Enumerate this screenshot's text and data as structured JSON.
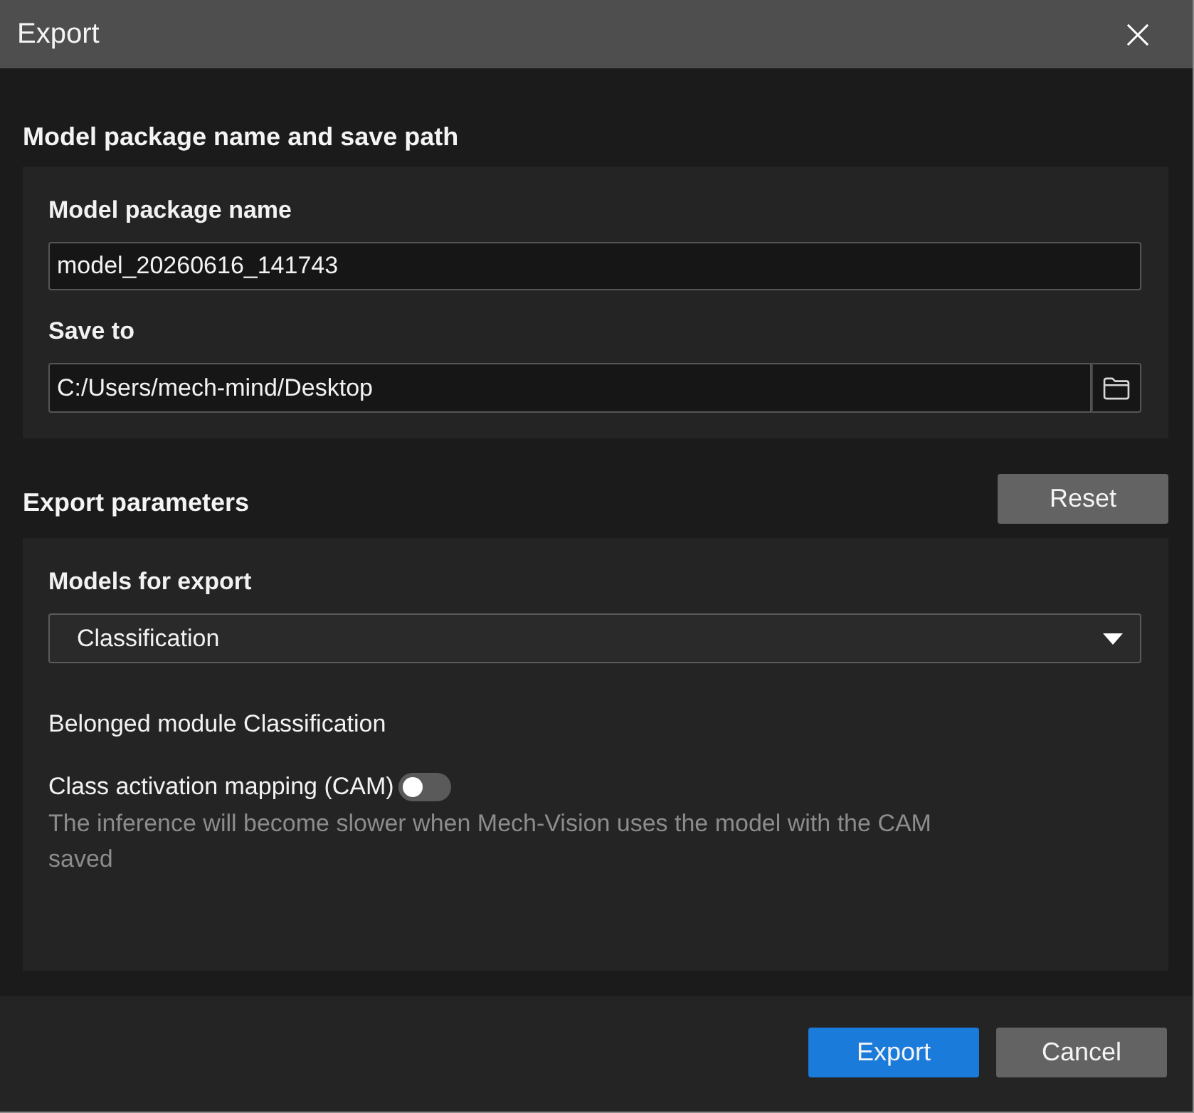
{
  "window": {
    "title": "Export"
  },
  "name_section": {
    "heading": "Model package name and save path",
    "package_name": {
      "label": "Model package name",
      "value": "model_20260616_141743"
    },
    "save_to": {
      "label": "Save to",
      "value": "C:/Users/mech-mind/Desktop"
    }
  },
  "parameters_section": {
    "heading": "Export parameters",
    "reset_button": "Reset",
    "models_for_export": {
      "label": "Models for export",
      "value": "Classification"
    },
    "belonged_module": "Belonged module Classification",
    "cam": {
      "label": "Class activation mapping (CAM)",
      "on": false,
      "hint": "The inference will become slower when Mech-Vision uses the model with the CAM saved"
    }
  },
  "buttons": [
    {
      "label": "Export",
      "kind": "primary"
    },
    {
      "label": "Cancel",
      "kind": "secondary"
    }
  ]
}
